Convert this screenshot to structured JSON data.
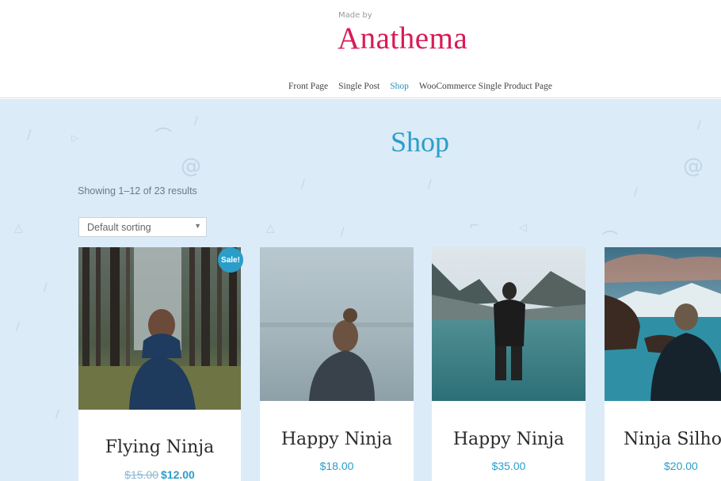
{
  "header": {
    "made_by": "Made by",
    "site_title": "Anathema"
  },
  "nav": {
    "items": [
      {
        "label": "Front Page",
        "active": false
      },
      {
        "label": "Single Post",
        "active": false
      },
      {
        "label": "Shop",
        "active": true
      },
      {
        "label": "WooCommerce Single Product Page",
        "active": false
      }
    ]
  },
  "shop": {
    "title": "Shop",
    "result_count": "Showing 1–12 of 23 results",
    "sorting": {
      "selected": "Default sorting"
    }
  },
  "products": [
    {
      "name": "Flying Ninja",
      "old_price": "$15.00",
      "price": "$12.00",
      "on_sale": true,
      "sale_label": "Sale!"
    },
    {
      "name": "Happy Ninja",
      "price": "$18.00"
    },
    {
      "name": "Happy Ninja",
      "price": "$35.00"
    },
    {
      "name": "Ninja Silhouette",
      "price": "$20.00"
    }
  ],
  "colors": {
    "brand": "#d81b55",
    "accent": "#2a9ec9",
    "background": "#dcebf8"
  }
}
